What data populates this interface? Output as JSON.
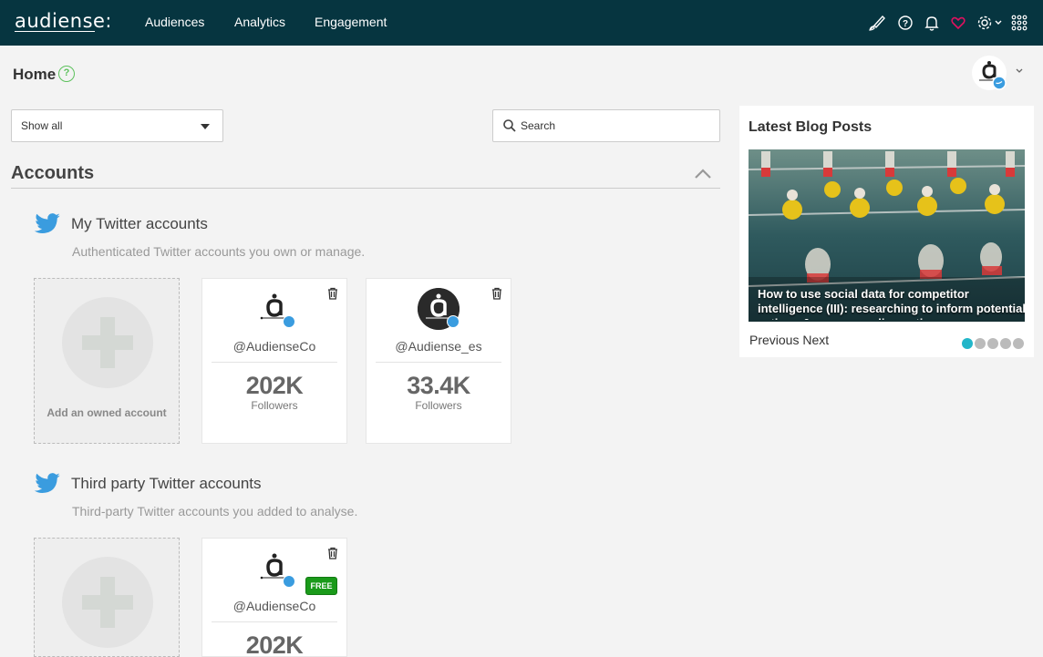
{
  "brand": {
    "logo_text": "audiense:"
  },
  "nav": {
    "links": [
      "Audiences",
      "Analytics",
      "Engagement"
    ],
    "icons": [
      "brush-icon",
      "help-icon",
      "bell-icon",
      "heart-icon",
      "settings-icon",
      "apps-grid-icon"
    ]
  },
  "page": {
    "title": "Home",
    "help": "?"
  },
  "filters": {
    "select_value": "Show all",
    "search_placeholder": "Search"
  },
  "accounts": {
    "title": "Accounts",
    "groups": [
      {
        "title": "My Twitter accounts",
        "subtitle": "Authenticated Twitter accounts you own or manage.",
        "add_label": "Add an owned account",
        "cards": [
          {
            "handle": "@AudienseCo",
            "count": "202K",
            "label": "Followers"
          },
          {
            "handle": "@Audiense_es",
            "count": "33.4K",
            "label": "Followers"
          }
        ]
      },
      {
        "title": "Third party Twitter accounts",
        "subtitle": "Third-party Twitter accounts you added to analyse.",
        "cards": [
          {
            "handle": "@AudienseCo",
            "count": "202K",
            "badge": "FREE"
          }
        ]
      }
    ]
  },
  "blog": {
    "title": "Latest Blog Posts",
    "post_title": "How to use social data for competitor intelligence (III): researching to inform potential actions & recommending actions",
    "prev": "Previous",
    "next": "Next",
    "slides": 5,
    "active_slide": 1
  },
  "colors": {
    "topnav": "#063540",
    "accent": "#22b6c9",
    "twitter": "#3a9cdf",
    "free": "#1a9a1a"
  }
}
